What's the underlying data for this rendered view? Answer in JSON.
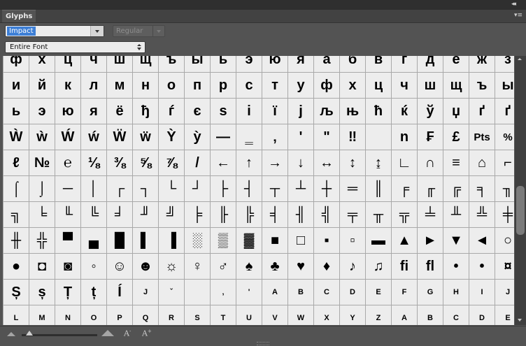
{
  "panel": {
    "tab_label": "Glyphs",
    "collapse_glyph": "◂◂",
    "menu_glyph": "▾≡"
  },
  "controls": {
    "font_family": "Impact",
    "font_style": "Regular",
    "show": "Entire Font"
  },
  "footer": {
    "decrease_label": "A",
    "increase_label": "A"
  },
  "glyphs": [
    "ф",
    "х",
    "ц",
    "ч",
    "ш",
    "щ",
    "ъ",
    "ы",
    "ь",
    "э",
    "ю",
    "я",
    "а",
    "б",
    "в",
    "г",
    "д",
    "е",
    "ж",
    "з",
    "и",
    "й",
    "к",
    "л",
    "м",
    "н",
    "о",
    "п",
    "р",
    "с",
    "т",
    "у",
    "ф",
    "х",
    "ц",
    "ч",
    "ш",
    "щ",
    "ъ",
    "ы",
    "ь",
    "э",
    "ю",
    "я",
    "ё",
    "ђ",
    "ѓ",
    "є",
    "s",
    "і",
    "ї",
    "j",
    "љ",
    "њ",
    "ћ",
    "ќ",
    "ў",
    "џ",
    "ґ",
    "ґ",
    "Ẁ",
    "ẁ",
    "Ẃ",
    "ẃ",
    "Ẅ",
    "ẅ",
    "Ỳ",
    "ỳ",
    "—",
    "‗",
    "‚",
    "'",
    "\"",
    "‼",
    "",
    "n",
    "₣",
    "£",
    "Pts",
    "%",
    "ℓ",
    "№",
    "℮",
    "⅛",
    "⅜",
    "⅝",
    "⅞",
    "/",
    "←",
    "↑",
    "→",
    "↓",
    "↔",
    "↕",
    "↨",
    "∟",
    "∩",
    "≡",
    "⌂",
    "⌐",
    "⌠",
    "⌡",
    "─",
    "│",
    "┌",
    "┐",
    "└",
    "┘",
    "├",
    "┤",
    "┬",
    "┴",
    "┼",
    "═",
    "║",
    "╒",
    "╓",
    "╔",
    "╕",
    "╖",
    "╗",
    "╘",
    "╙",
    "╚",
    "╛",
    "╜",
    "╝",
    "╞",
    "╟",
    "╠",
    "╡",
    "╢",
    "╣",
    "╤",
    "╥",
    "╦",
    "╧",
    "╨",
    "╩",
    "╪",
    "╫",
    "╬",
    "▀",
    "▄",
    "█",
    "▌",
    "▐",
    "░",
    "▒",
    "▓",
    "■",
    "□",
    "▪",
    "▫",
    "▬",
    "▲",
    "►",
    "▼",
    "◄",
    "○",
    "●",
    "◘",
    "◙",
    "◦",
    "☺",
    "☻",
    "☼",
    "♀",
    "♂",
    "♠",
    "♣",
    "♥",
    "♦",
    "♪",
    "♫",
    "ﬁ",
    "ﬂ",
    "•",
    "•",
    "¤",
    "Ș",
    "ș",
    "Ț",
    "ț",
    "Í",
    "J",
    "ˇ",
    "",
    "‚",
    "'",
    "A",
    "B",
    "C",
    "D",
    "E",
    "F",
    "G",
    "H",
    "I",
    "J",
    "L",
    "M",
    "N",
    "O",
    "P",
    "Q",
    "R",
    "S",
    "T",
    "U",
    "V",
    "W",
    "X",
    "Y",
    "Z",
    "A",
    "B",
    "C",
    "D",
    "E"
  ]
}
